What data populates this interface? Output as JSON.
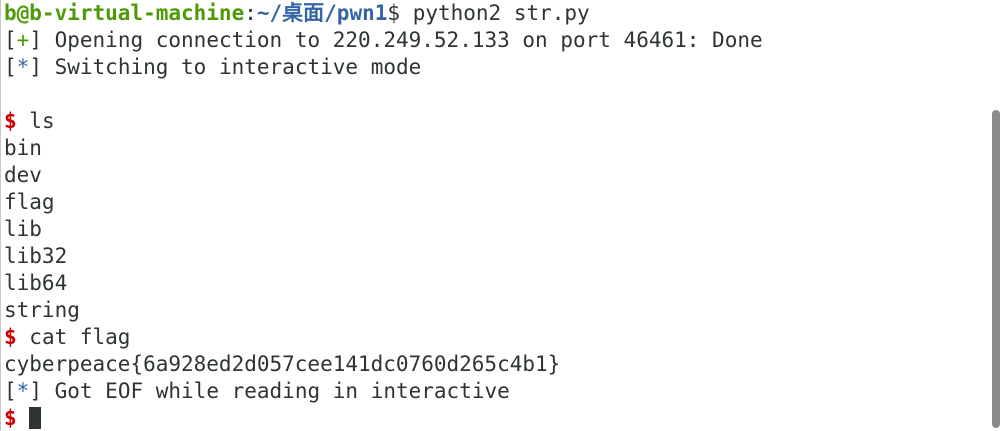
{
  "terminal": {
    "prompt": {
      "user_host": "b@b-virtual-machine",
      "separator": ":",
      "path": "~/桌面/pwn1",
      "dollar": "$",
      "command": " python2 str.py"
    },
    "lines": {
      "open_tag_open": "[",
      "open_tag_sym": "+",
      "open_tag_close": "]",
      "open_text": " Opening connection to 220.249.52.133 on port 46461: Done",
      "switch_tag_open": "[",
      "switch_tag_sym": "*",
      "switch_tag_close": "]",
      "switch_text": " Switching to interactive mode",
      "ls_dollar": "$",
      "ls_cmd": " ls",
      "listing": [
        "bin",
        "dev",
        "flag",
        "lib",
        "lib32",
        "lib64",
        "string"
      ],
      "cat_dollar": "$",
      "cat_cmd": " cat flag",
      "flag_value": "cyberpeace{6a928ed2d057cee141dc0760d265c4b1}",
      "eof_tag_open": "[",
      "eof_tag_sym": "*",
      "eof_tag_close": "]",
      "eof_text": " Got EOF while reading in interactive",
      "final_dollar": "$"
    },
    "colors": {
      "user_host": "#4e9a06",
      "path": "#3465a4",
      "dollar": "#cc0000",
      "plus_tag": "#4e9a06",
      "star_tag": "#3465a4",
      "foreground": "#2e3436",
      "background": "#ffffff"
    },
    "icons": {
      "cursor": "block-cursor-icon"
    }
  }
}
